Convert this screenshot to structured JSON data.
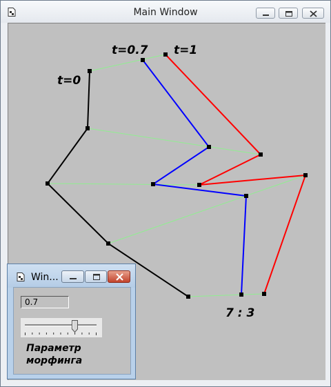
{
  "main_window": {
    "title": "Main Window",
    "labels": {
      "t0": "t=0",
      "t07": "t=0.7",
      "t1": "t=1",
      "ratio": "7 : 3"
    },
    "colors": {
      "background": "#c0c0c0",
      "source_polyline": "#000000",
      "morph_polyline": "#0000ff",
      "target_polyline": "#ff0000",
      "correspondence_lines": "#90ee90"
    },
    "morph_parameter": 0.7
  },
  "sub_window": {
    "title": "Win...",
    "value": "0.7",
    "slider_value": 0.7,
    "caption_line1": "Параметр",
    "caption_line2": "морфинга"
  }
}
